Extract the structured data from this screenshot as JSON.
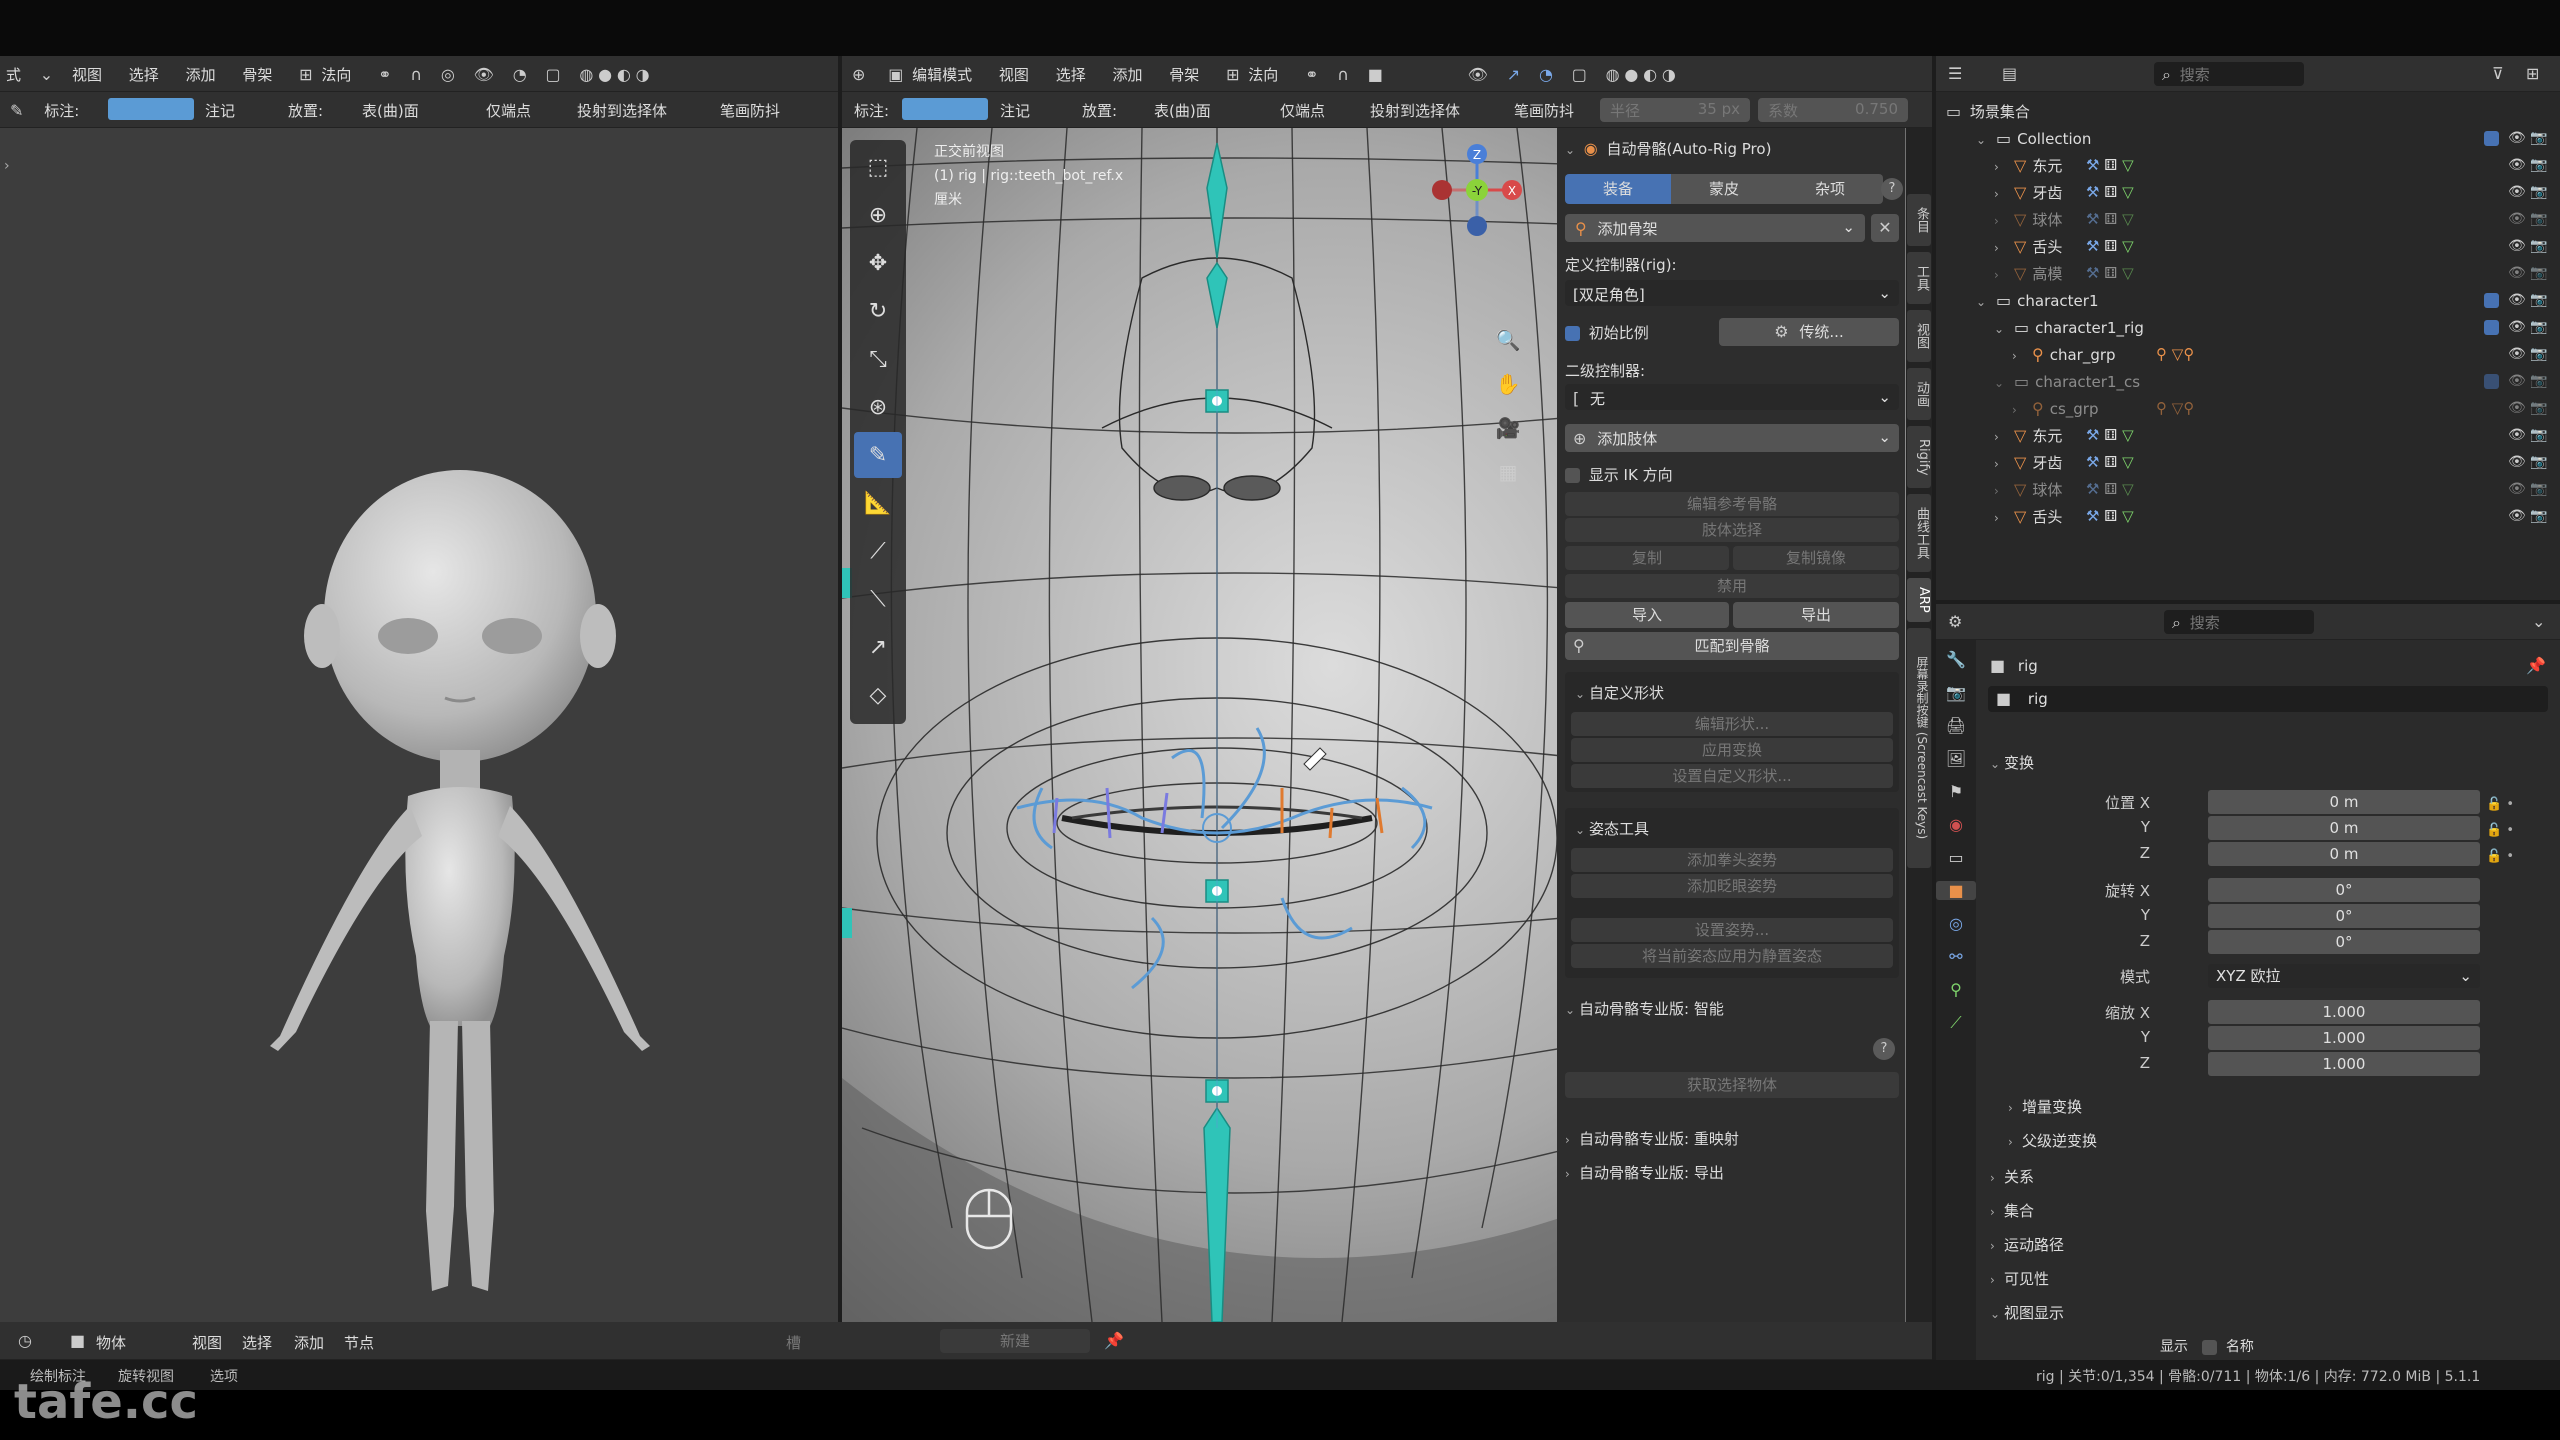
{
  "top_menu_left": [
    "视图",
    "选择",
    "添加",
    "骨架"
  ],
  "left_mode": "式",
  "left_orient": "法向",
  "tool_header_left": {
    "label": "标注:",
    "note": "注记",
    "place_label": "放置:",
    "place_value": "表(曲)面",
    "only_ends": "仅端点",
    "project": "投射到选择体",
    "stabilize": "笔画防抖"
  },
  "center_header": {
    "mode": "编辑模式",
    "menus": [
      "视图",
      "选择",
      "添加",
      "骨架"
    ],
    "orient": "法向"
  },
  "tool_header_center": {
    "label": "标注:",
    "note": "注记",
    "place_label": "放置:",
    "place_value": "表(曲)面",
    "only_ends": "仅端点",
    "project": "投射到选择体",
    "stabilize": "笔画防抖",
    "radius_label": "半径",
    "radius_value": "35 px",
    "factor_label": "系数",
    "factor_value": "0.750"
  },
  "viewport_overlay": {
    "line1": "正交前视图",
    "line2": "(1) rig | rig::teeth_bot_ref.x",
    "line3": "厘米"
  },
  "gizmo": {
    "z": "Z",
    "y": "-Y",
    "x": "X"
  },
  "arp_panel": {
    "title": "自动骨骼(Auto-Rig Pro)",
    "tabs": [
      "装备",
      "蒙皮",
      "杂项"
    ],
    "add_armature": "添加骨架",
    "define_rig_label": "定义控制器(rig):",
    "define_rig_value": "[双足角色]",
    "init_scale": "初始比例",
    "legacy": "传统...",
    "secondary_label": "二级控制器:",
    "secondary_value": "无",
    "add_limb": "添加肢体",
    "show_ik": "显示 IK 方向",
    "edit_ref": "编辑参考骨骼",
    "limb_select": "肢体选择",
    "copy": "复制",
    "copy_mirror": "复制镜像",
    "disable": "禁用",
    "import": "导入",
    "export": "导出",
    "match": "匹配到骨骼",
    "custom_shape": "自定义形状",
    "edit_shape": "编辑形状...",
    "apply_transform": "应用变换",
    "set_custom_shape": "设置自定义形状...",
    "pose_tools": "姿态工具",
    "add_fist": "添加拳头姿势",
    "add_blink": "添加眨眼姿势",
    "set_pose": "设置姿势...",
    "apply_rest": "将当前姿态应用为静置姿态",
    "smart_title": "自动骨骼专业版: 智能",
    "get_selected": "获取选择物体",
    "remap_title": "自动骨骼专业版: 重映射",
    "export_title": "自动骨骼专业版: 导出"
  },
  "side_tabs": [
    "条目",
    "工具",
    "视图",
    "动画",
    "Rigify",
    "曲线工具",
    "ARP",
    "屏幕录制按键 (Screencast Keys)"
  ],
  "outliner": {
    "search_placeholder": "搜索",
    "root": "场景集合",
    "items": [
      {
        "name": "Collection",
        "depth": 1,
        "type": "collection"
      },
      {
        "name": "东元",
        "depth": 2,
        "type": "mesh"
      },
      {
        "name": "牙齿",
        "depth": 2,
        "type": "mesh"
      },
      {
        "name": "球体",
        "depth": 2,
        "type": "mesh",
        "dim": true
      },
      {
        "name": "舌头",
        "depth": 2,
        "type": "mesh"
      },
      {
        "name": "高模",
        "depth": 2,
        "type": "mesh",
        "dim": true
      },
      {
        "name": "character1",
        "depth": 1,
        "type": "collection"
      },
      {
        "name": "character1_rig",
        "depth": 2,
        "type": "collection"
      },
      {
        "name": "char_grp",
        "depth": 3,
        "type": "armature"
      },
      {
        "name": "character1_cs",
        "depth": 2,
        "type": "collection",
        "dim": true
      },
      {
        "name": "cs_grp",
        "depth": 3,
        "type": "armature",
        "dim": true
      },
      {
        "name": "东元",
        "depth": 2,
        "type": "mesh"
      },
      {
        "name": "牙齿",
        "depth": 2,
        "type": "mesh"
      },
      {
        "name": "球体",
        "depth": 2,
        "type": "mesh",
        "dim": true
      },
      {
        "name": "舌头",
        "depth": 2,
        "type": "mesh"
      }
    ]
  },
  "properties": {
    "search_placeholder": "搜索",
    "object_name": "rig",
    "object_field": "rig",
    "transform": "变换",
    "loc_x_label": "位置 X",
    "loc_x": "0 m",
    "loc_y_label": "Y",
    "loc_y": "0 m",
    "loc_z_label": "Z",
    "loc_z": "0 m",
    "rot_x_label": "旋转 X",
    "rot_x": "0°",
    "rot_y_label": "Y",
    "rot_y": "0°",
    "rot_z_label": "Z",
    "rot_z": "0°",
    "mode_label": "模式",
    "mode_value": "XYZ 欧拉",
    "scale_x_label": "缩放 X",
    "scale_x": "1.000",
    "scale_y_label": "Y",
    "scale_y": "1.000",
    "scale_z_label": "Z",
    "scale_z": "1.000",
    "delta": "增量变换",
    "parent_inv": "父级逆变换",
    "relations": "关系",
    "collections": "集合",
    "motion_paths": "运动路径",
    "visibility": "可见性",
    "viewport_display": "视图显示",
    "show_label": "显示",
    "name_label": "名称"
  },
  "bottom_bar": {
    "editor": "物体",
    "menus": [
      "视图",
      "选择",
      "添加",
      "节点"
    ],
    "slot": "槽",
    "new": "新建"
  },
  "status_bar": {
    "left": [
      "绘制标注",
      "旋转视图",
      "选项"
    ],
    "right": "rig | 关节:0/1,354 | 骨骼:0/711 | 物体:1/6 | 内存: 772.0 MiB | 5.1.1"
  },
  "watermark": "tafe.cc",
  "colors": {
    "accent": "#4772b3",
    "bone": "#2fc4b8",
    "curve": "#5b9bd5"
  }
}
